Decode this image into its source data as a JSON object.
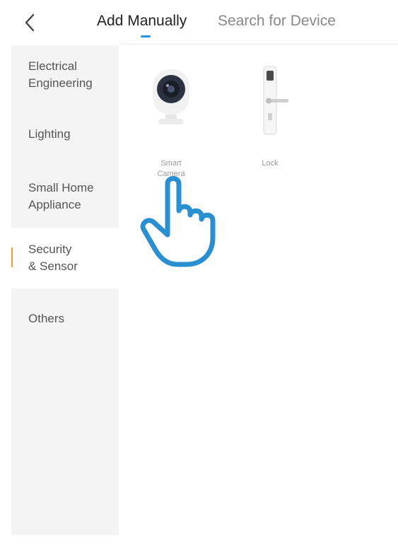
{
  "header": {
    "back_icon": "chevron-left-icon",
    "tabs": [
      {
        "label": "Add Manually",
        "active": true
      },
      {
        "label": "Search for Device",
        "active": false
      }
    ]
  },
  "sidebar": {
    "items": [
      {
        "label": "Electrical\nEngineering",
        "active": false
      },
      {
        "label": "Lighting",
        "active": false
      },
      {
        "label": "Small Home\nAppliance",
        "active": false
      },
      {
        "label": "Security\n& Sensor",
        "active": true
      },
      {
        "label": "Others",
        "active": false
      }
    ]
  },
  "devices": [
    {
      "label": "Smart\nCamera",
      "icon": "smart-camera-icon"
    },
    {
      "label": "Lock",
      "icon": "door-lock-icon"
    }
  ],
  "overlay": {
    "icon": "pointing-hand-icon"
  },
  "colors": {
    "tab_indicator": "#2f8fe0",
    "active_marker": "#f29b35",
    "sidebar_bg": "#f4f4f4",
    "hand_outline": "#2a8fd0"
  }
}
